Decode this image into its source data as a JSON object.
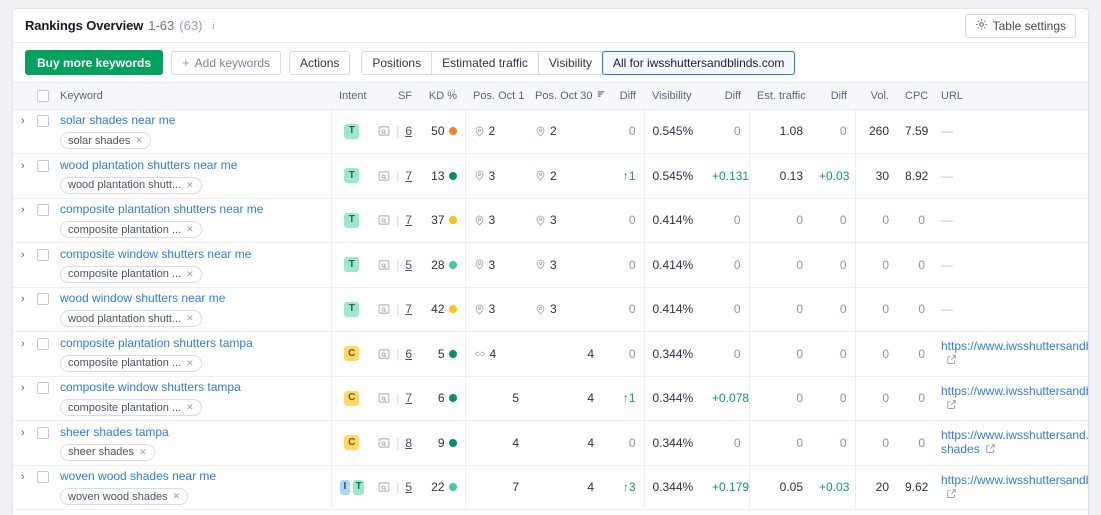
{
  "header": {
    "title": "Rankings Overview",
    "range": "1-63",
    "count": "(63)",
    "info_icon": "info-icon",
    "table_settings_label": "Table settings",
    "gear_icon": "gear-icon"
  },
  "toolbar": {
    "buy_label": "Buy more keywords",
    "add_label": "Add keywords",
    "add_plus": "+",
    "actions_label": "Actions",
    "segments": [
      {
        "label": "Positions",
        "active": false
      },
      {
        "label": "Estimated traffic",
        "active": false
      },
      {
        "label": "Visibility",
        "active": false
      },
      {
        "label": "All for iwsshuttersandblinds.com",
        "active": true
      }
    ]
  },
  "table": {
    "columns": [
      {
        "key": "keyword",
        "label": "Keyword",
        "align": "lft"
      },
      {
        "key": "intent",
        "label": "Intent",
        "align": "ctr"
      },
      {
        "key": "sf",
        "label": "SF",
        "align": "num"
      },
      {
        "key": "kd",
        "label": "KD %",
        "align": "num"
      },
      {
        "key": "pos1",
        "label": "Pos. Oct 1",
        "align": "lft"
      },
      {
        "key": "pos30",
        "label": "Pos. Oct 30",
        "align": "lft",
        "sorted": true,
        "sort_icon": "sort-icon"
      },
      {
        "key": "posdiff",
        "label": "Diff",
        "align": "num"
      },
      {
        "key": "vis",
        "label": "Visibility",
        "align": "lft"
      },
      {
        "key": "visdiff",
        "label": "Diff",
        "align": "num"
      },
      {
        "key": "traffic",
        "label": "Est. traffic",
        "align": "lft"
      },
      {
        "key": "trafdiff",
        "label": "Diff",
        "align": "num"
      },
      {
        "key": "vol",
        "label": "Vol.",
        "align": "num"
      },
      {
        "key": "cpc",
        "label": "CPC",
        "align": "num"
      },
      {
        "key": "url",
        "label": "URL",
        "align": "lft"
      }
    ],
    "select_all_checkbox": false,
    "rows": [
      {
        "keyword": "solar shades near me",
        "tag": "solar shades",
        "intents": [
          "T"
        ],
        "sf": "6",
        "kd": "50",
        "kd_color": "#f97b2c",
        "pos1": "2",
        "pos1_icon": "map-pin-icon",
        "pos30": "2",
        "pos30_icon": "map-pin-icon",
        "posdiff": "0",
        "posdiff_state": "zero",
        "vis": "0.545%",
        "visdiff": "0",
        "visdiff_state": "zero",
        "traffic": "1.08",
        "trafdiff": "0",
        "trafdiff_state": "zero",
        "vol": "260",
        "vol_state": "normal",
        "cpc": "7.59",
        "cpc_state": "normal",
        "url": "",
        "url_state": "dash"
      },
      {
        "keyword": "wood plantation shutters near me",
        "tag": "wood plantation shutt...",
        "intents": [
          "T"
        ],
        "sf": "7",
        "kd": "13",
        "kd_color": "#0b8f5e",
        "pos1": "3",
        "pos1_icon": "map-pin-icon",
        "pos30": "2",
        "pos30_icon": "map-pin-icon",
        "posdiff": "↑1",
        "posdiff_state": "up",
        "vis": "0.545%",
        "visdiff": "+0.131",
        "visdiff_state": "up",
        "traffic": "0.13",
        "trafdiff": "+0.03",
        "trafdiff_state": "up",
        "vol": "30",
        "vol_state": "normal",
        "cpc": "8.92",
        "cpc_state": "normal",
        "url": "",
        "url_state": "dash"
      },
      {
        "keyword": "composite plantation shutters near me",
        "tag": "composite plantation ...",
        "intents": [
          "T"
        ],
        "sf": "7",
        "kd": "37",
        "kd_color": "#ffc114",
        "pos1": "3",
        "pos1_icon": "map-pin-icon",
        "pos30": "3",
        "pos30_icon": "map-pin-icon",
        "posdiff": "0",
        "posdiff_state": "zero",
        "vis": "0.414%",
        "visdiff": "0",
        "visdiff_state": "zero",
        "traffic": "0",
        "traffic_state": "zero",
        "trafdiff": "0",
        "trafdiff_state": "zero",
        "vol": "0",
        "vol_state": "zero",
        "cpc": "0",
        "cpc_state": "zero",
        "url": "",
        "url_state": "dash"
      },
      {
        "keyword": "composite window shutters near me",
        "tag": "composite plantation ...",
        "intents": [
          "T"
        ],
        "sf": "5",
        "kd": "28",
        "kd_color": "#3fcf8e",
        "pos1": "3",
        "pos1_icon": "map-pin-icon",
        "pos30": "3",
        "pos30_icon": "map-pin-icon",
        "posdiff": "0",
        "posdiff_state": "zero",
        "vis": "0.414%",
        "visdiff": "0",
        "visdiff_state": "zero",
        "traffic": "0",
        "traffic_state": "zero",
        "trafdiff": "0",
        "trafdiff_state": "zero",
        "vol": "0",
        "vol_state": "zero",
        "cpc": "0",
        "cpc_state": "zero",
        "url": "",
        "url_state": "dash"
      },
      {
        "keyword": "wood window shutters near me",
        "tag": "wood plantation shutt...",
        "intents": [
          "T"
        ],
        "sf": "7",
        "kd": "42",
        "kd_color": "#ffc114",
        "pos1": "3",
        "pos1_icon": "map-pin-icon",
        "pos30": "3",
        "pos30_icon": "map-pin-icon",
        "posdiff": "0",
        "posdiff_state": "zero",
        "vis": "0.414%",
        "visdiff": "0",
        "visdiff_state": "zero",
        "traffic": "0",
        "traffic_state": "zero",
        "trafdiff": "0",
        "trafdiff_state": "zero",
        "vol": "0",
        "vol_state": "zero",
        "cpc": "0",
        "cpc_state": "zero",
        "url": "",
        "url_state": "dash"
      },
      {
        "keyword": "composite plantation shutters tampa",
        "tag": "composite plantation ...",
        "intents": [
          "C"
        ],
        "sf": "6",
        "kd": "5",
        "kd_color": "#0b8f5e",
        "pos1": "4",
        "pos1_icon": "link-icon",
        "pos30": "4",
        "pos30_icon": "",
        "posdiff": "0",
        "posdiff_state": "zero",
        "vis": "0.344%",
        "visdiff": "0",
        "visdiff_state": "zero",
        "traffic": "0",
        "traffic_state": "zero",
        "trafdiff": "0",
        "trafdiff_state": "zero",
        "vol": "0",
        "vol_state": "zero",
        "cpc": "0",
        "cpc_state": "zero",
        "url": "https://www.iwsshuttersandblinds.com/",
        "url_state": "link"
      },
      {
        "keyword": "composite window shutters tampa",
        "tag": "composite plantation ...",
        "intents": [
          "C"
        ],
        "sf": "7",
        "kd": "6",
        "kd_color": "#0b8f5e",
        "pos1": "5",
        "pos1_icon": "",
        "pos30": "4",
        "pos30_icon": "",
        "posdiff": "↑1",
        "posdiff_state": "up",
        "vis": "0.344%",
        "visdiff": "+0.078",
        "visdiff_state": "up",
        "traffic": "0",
        "traffic_state": "zero",
        "trafdiff": "0",
        "trafdiff_state": "zero",
        "vol": "0",
        "vol_state": "zero",
        "cpc": "0",
        "cpc_state": "zero",
        "url": "https://www.iwsshuttersandblinds.com/",
        "url_state": "link"
      },
      {
        "keyword": "sheer shades tampa",
        "tag": "sheer shades",
        "intents": [
          "C"
        ],
        "sf": "8",
        "kd": "9",
        "kd_color": "#0b8f5e",
        "pos1": "4",
        "pos1_icon": "",
        "pos30": "4",
        "pos30_icon": "",
        "posdiff": "0",
        "posdiff_state": "zero",
        "vis": "0.344%",
        "visdiff": "0",
        "visdiff_state": "zero",
        "traffic": "0",
        "traffic_state": "zero",
        "trafdiff": "0",
        "trafdiff_state": "zero",
        "vol": "0",
        "vol_state": "zero",
        "cpc": "0",
        "cpc_state": "zero",
        "url": "https://www.iwsshuttersand.../sheer-shades",
        "url_state": "link"
      },
      {
        "keyword": "woven wood shades near me",
        "tag": "woven wood shades",
        "intents": [
          "I",
          "T"
        ],
        "sf": "5",
        "kd": "22",
        "kd_color": "#3fcf8e",
        "pos1": "7",
        "pos1_icon": "",
        "pos30": "4",
        "pos30_icon": "",
        "posdiff": "↑3",
        "posdiff_state": "up",
        "vis": "0.344%",
        "visdiff": "+0.179",
        "visdiff_state": "up",
        "traffic": "0.05",
        "trafdiff": "+0.03",
        "trafdiff_state": "up",
        "vol": "20",
        "vol_state": "normal",
        "cpc": "9.62",
        "cpc_state": "normal",
        "url": "https://www.iwsshuttersandblinds.com/",
        "url_state": "link"
      }
    ]
  },
  "colors": {
    "brand_green": "#06a05f",
    "link_blue": "#337ae0",
    "accent_blue": "#1c7ed6",
    "positive": "#0f9d69"
  }
}
